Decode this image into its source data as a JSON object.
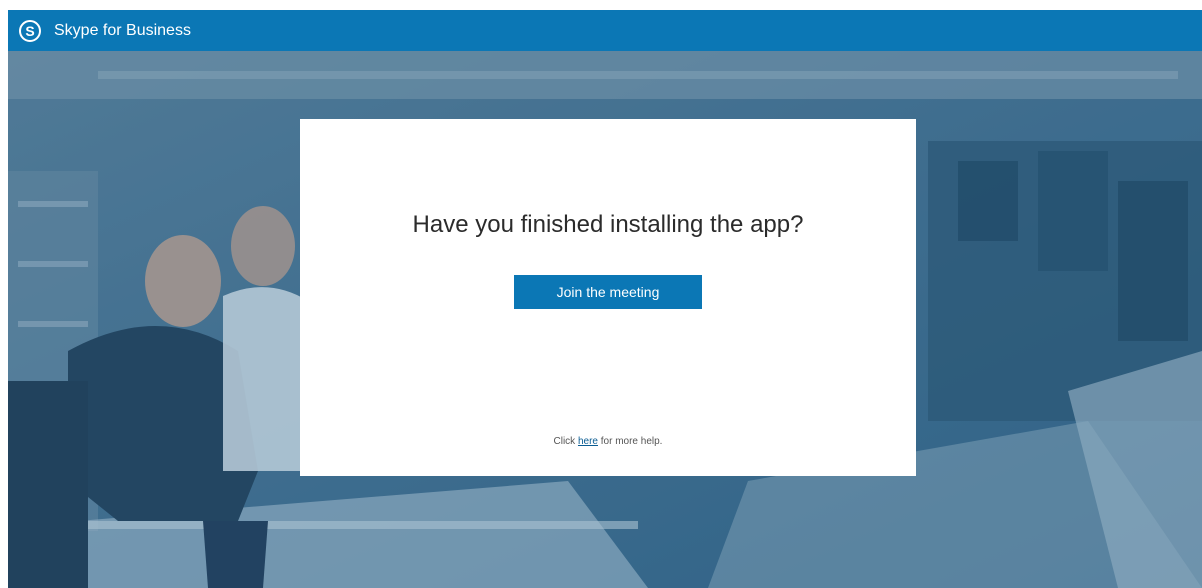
{
  "header": {
    "app_title": "Skype for Business",
    "logo_icon": "skype-s-icon"
  },
  "dialog": {
    "title": "Have you finished installing the app?",
    "join_button_label": "Join the meeting",
    "help_prefix": "Click ",
    "help_link": "here",
    "help_suffix": " for more help."
  },
  "colors": {
    "brand_blue": "#0b77b5",
    "background_overlay": "#3f6c8d",
    "card": "#ffffff"
  }
}
